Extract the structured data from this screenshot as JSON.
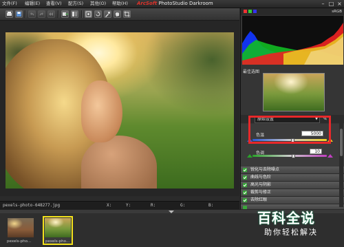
{
  "menu": {
    "items": [
      "文件(F)",
      "编辑(E)",
      "查看(V)",
      "配方(S)",
      "其他(O)",
      "帮助(H)"
    ],
    "app_brand": "ArcSoft",
    "app_title": "PhotoStudio Darkroom"
  },
  "window_controls": [
    "–",
    "□",
    "×"
  ],
  "status": {
    "filename": "pexels-photo-648277.jpg",
    "x_label": "X:",
    "y_label": "Y:",
    "r_label": "R:",
    "g_label": "G:",
    "b_label": "B:"
  },
  "filmstrip": {
    "thumbs": [
      {
        "caption": "pexels-pho...",
        "selected": false
      },
      {
        "caption": "pexels-pho...",
        "selected": true
      }
    ]
  },
  "panel": {
    "color_space": "sRGB",
    "navigator_label": "最佳选图",
    "preset": "原始设置",
    "adjustments": [
      {
        "label": "色温",
        "value": "5000",
        "slider_fraction": 0.54
      },
      {
        "label": "色调",
        "value": "10",
        "slider_fraction": 0.55
      }
    ],
    "sections": [
      {
        "label": "锐化与去除噪点",
        "undo": "↶"
      },
      {
        "label": "曲线与色阶",
        "undo": "↶"
      },
      {
        "label": "高光与阴影",
        "undo": "↶"
      },
      {
        "label": "裁剪与修正",
        "undo": "↶"
      },
      {
        "label": "去除红眼",
        "undo": "↶"
      },
      {
        "label": "",
        "undo": "↶"
      }
    ]
  },
  "watermark": {
    "title": "百科全说",
    "subtitle": "助你轻松解决"
  },
  "colors": {
    "accent_red": "#e8282a",
    "selection_yellow": "#f4e21b",
    "check_green": "#3aa43a"
  }
}
